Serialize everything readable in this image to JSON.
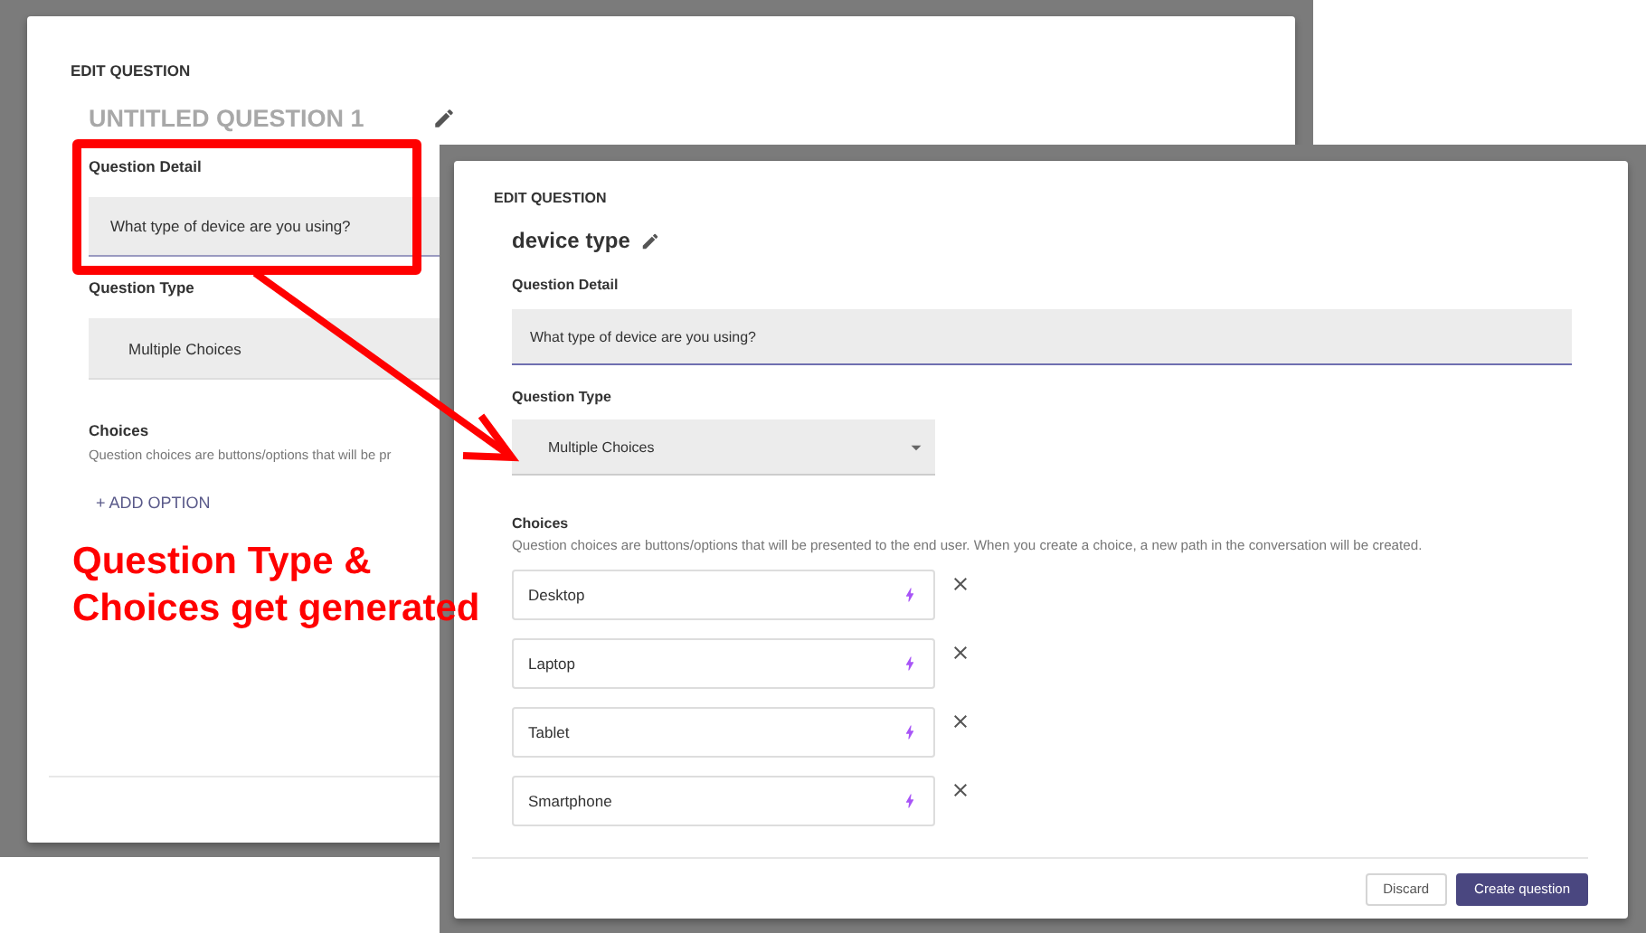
{
  "before_dialog": {
    "heading": "EDIT QUESTION",
    "title": "UNTITLED QUESTION 1",
    "title_is_placeholder": true,
    "detail_label": "Question Detail",
    "detail_value": "What type of device are you using?",
    "type_label": "Question Type",
    "type_value": "Multiple Choices",
    "choices_label": "Choices",
    "choices_description": "Question choices are buttons/options that will be pr",
    "add_option": "+ ADD OPTION"
  },
  "after_dialog": {
    "heading": "EDIT QUESTION",
    "title": "device type",
    "title_is_placeholder": false,
    "detail_label": "Question Detail",
    "detail_value": "What type of device are you using?",
    "type_label": "Question Type",
    "type_value": "Multiple Choices",
    "choices_label": "Choices",
    "choices_description": "Question choices are buttons/options that will be presented to the end user. When you create a choice, a new path in the conversation will be created.",
    "choices": [
      {
        "label": "Desktop"
      },
      {
        "label": "Laptop"
      },
      {
        "label": "Tablet"
      },
      {
        "label": "Smartphone"
      }
    ],
    "buttons": [
      {
        "label": "Discard",
        "kind": "secondary"
      },
      {
        "label": "Create question",
        "kind": "primary"
      }
    ]
  },
  "annotation": {
    "text": "Question Type & Choices get generated"
  }
}
